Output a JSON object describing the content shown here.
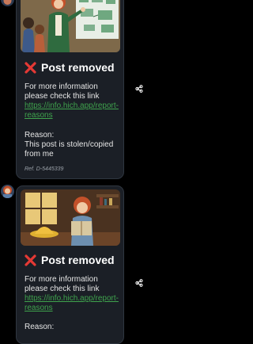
{
  "posts": [
    {
      "image_alt": "Illustration of a red-haired woman in a green jacket presenting whiteboard charts to children",
      "removed_title": "Post removed",
      "info_text": "For more information please check this link",
      "info_link": "https://info.hich.app/report-reasons",
      "reason_label": "Reason:",
      "reason_text": "This post is stolen/copied from me",
      "ref": "Ref. D-5445339"
    },
    {
      "image_alt": "Illustration of a red-haired girl in a cozy room holding a book, with a yellow hat on the table",
      "removed_title": "Post removed",
      "info_text": "For more information please check this link",
      "info_link": "https://info.hich.app/report-reasons",
      "reason_label": "Reason:"
    }
  ],
  "icons": {
    "removed": "close-icon",
    "share": "share-icon",
    "avatar": "avatar"
  },
  "colors": {
    "background": "#000000",
    "card": "#1b1f26",
    "link": "#3fa34d",
    "removed_x": "#e53935"
  }
}
